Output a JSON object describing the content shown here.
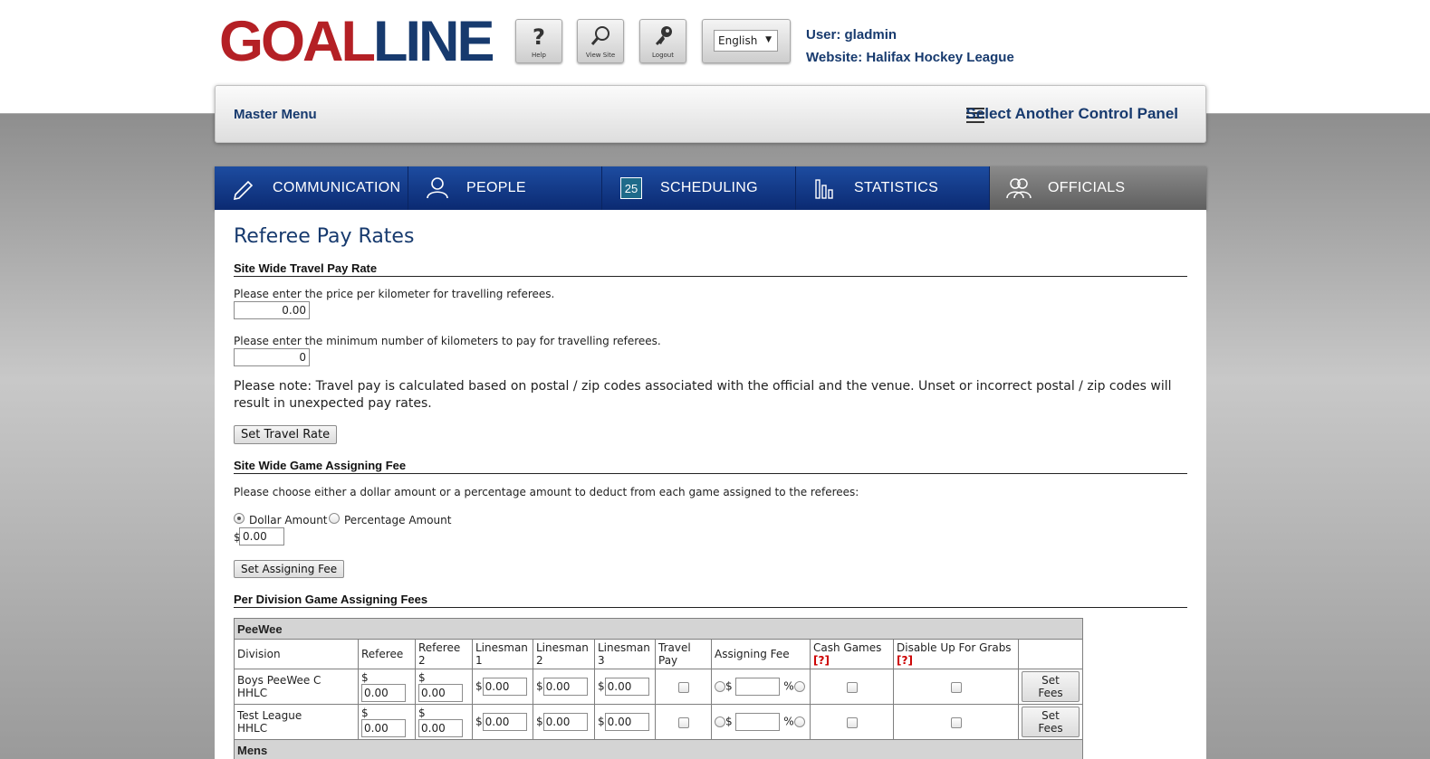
{
  "header": {
    "logo_part1": "GOAL",
    "logo_part2": "LINE",
    "help_label": "Help",
    "view_site_label": "View Site",
    "logout_label": "Logout",
    "language_selected": "English",
    "user_line": "User: gladmin",
    "website_line": "Website: Halifax Hockey League",
    "icons": {
      "help": "question-icon",
      "view_site": "magnifier-icon",
      "logout": "key-icon"
    }
  },
  "menubar": {
    "master_menu": "Master Menu",
    "select_panel": "Select Another Control Panel"
  },
  "nav": {
    "tabs": [
      {
        "label": "COMMUNICATION",
        "icon": "pencil-icon",
        "glyph": "✎"
      },
      {
        "label": "PEOPLE",
        "icon": "person-icon",
        "glyph": "👤"
      },
      {
        "label": "SCHEDULING",
        "icon": "calendar-icon",
        "glyph": "25"
      },
      {
        "label": "STATISTICS",
        "icon": "bar-chart-icon",
        "glyph": "▮▯"
      },
      {
        "label": "OFFICIALS",
        "icon": "officials-icon",
        "glyph": "👥"
      }
    ],
    "active": "OFFICIALS"
  },
  "page": {
    "title": "Referee Pay Rates",
    "travel": {
      "heading": "Site Wide Travel Pay Rate",
      "price_prompt": "Please enter the price per kilometer for travelling referees.",
      "price_value": "0.00",
      "min_prompt": "Please enter the minimum number of kilometers to pay for travelling referees.",
      "min_value": "0",
      "note": "Please note: Travel pay is calculated based on postal / zip codes associated with the official and the venue. Unset or incorrect postal / zip codes will result in unexpected pay rates.",
      "button": "Set Travel Rate"
    },
    "assigning": {
      "heading": "Site Wide Game Assigning Fee",
      "prompt": "Please choose either a dollar amount or a percentage amount to deduct from each game assigned to the referees:",
      "dollar_label": "Dollar Amount",
      "percent_label": "Percentage Amount",
      "selected": "Dollar Amount",
      "currency": "$",
      "value": "0.00",
      "button": "Set Assigning Fee"
    },
    "per_division": {
      "heading": "Per Division Game Assigning Fees",
      "columns": [
        "Division",
        "Referee",
        "Referee 2",
        "Linesman 1",
        "Linesman 2",
        "Linesman 3",
        "Travel Pay",
        "Assigning Fee",
        "Cash Games",
        "Disable Up For Grabs"
      ],
      "help_mark": "[?]",
      "groups": [
        {
          "name": "PeeWee",
          "rows": [
            {
              "division": "Boys PeeWee C",
              "org": "HHLC",
              "referee": "0.00",
              "referee2": "0.00",
              "linesman1": "0.00",
              "linesman2": "0.00",
              "linesman3": "0.00",
              "button": "Set Fees"
            },
            {
              "division": "Test League",
              "org": "HHLC",
              "referee": "0.00",
              "referee2": "0.00",
              "linesman1": "0.00",
              "linesman2": "0.00",
              "linesman3": "0.00",
              "button": "Set Fees"
            }
          ]
        },
        {
          "name": "Mens",
          "rows": []
        }
      ],
      "currency": "$",
      "percent": "%"
    }
  }
}
